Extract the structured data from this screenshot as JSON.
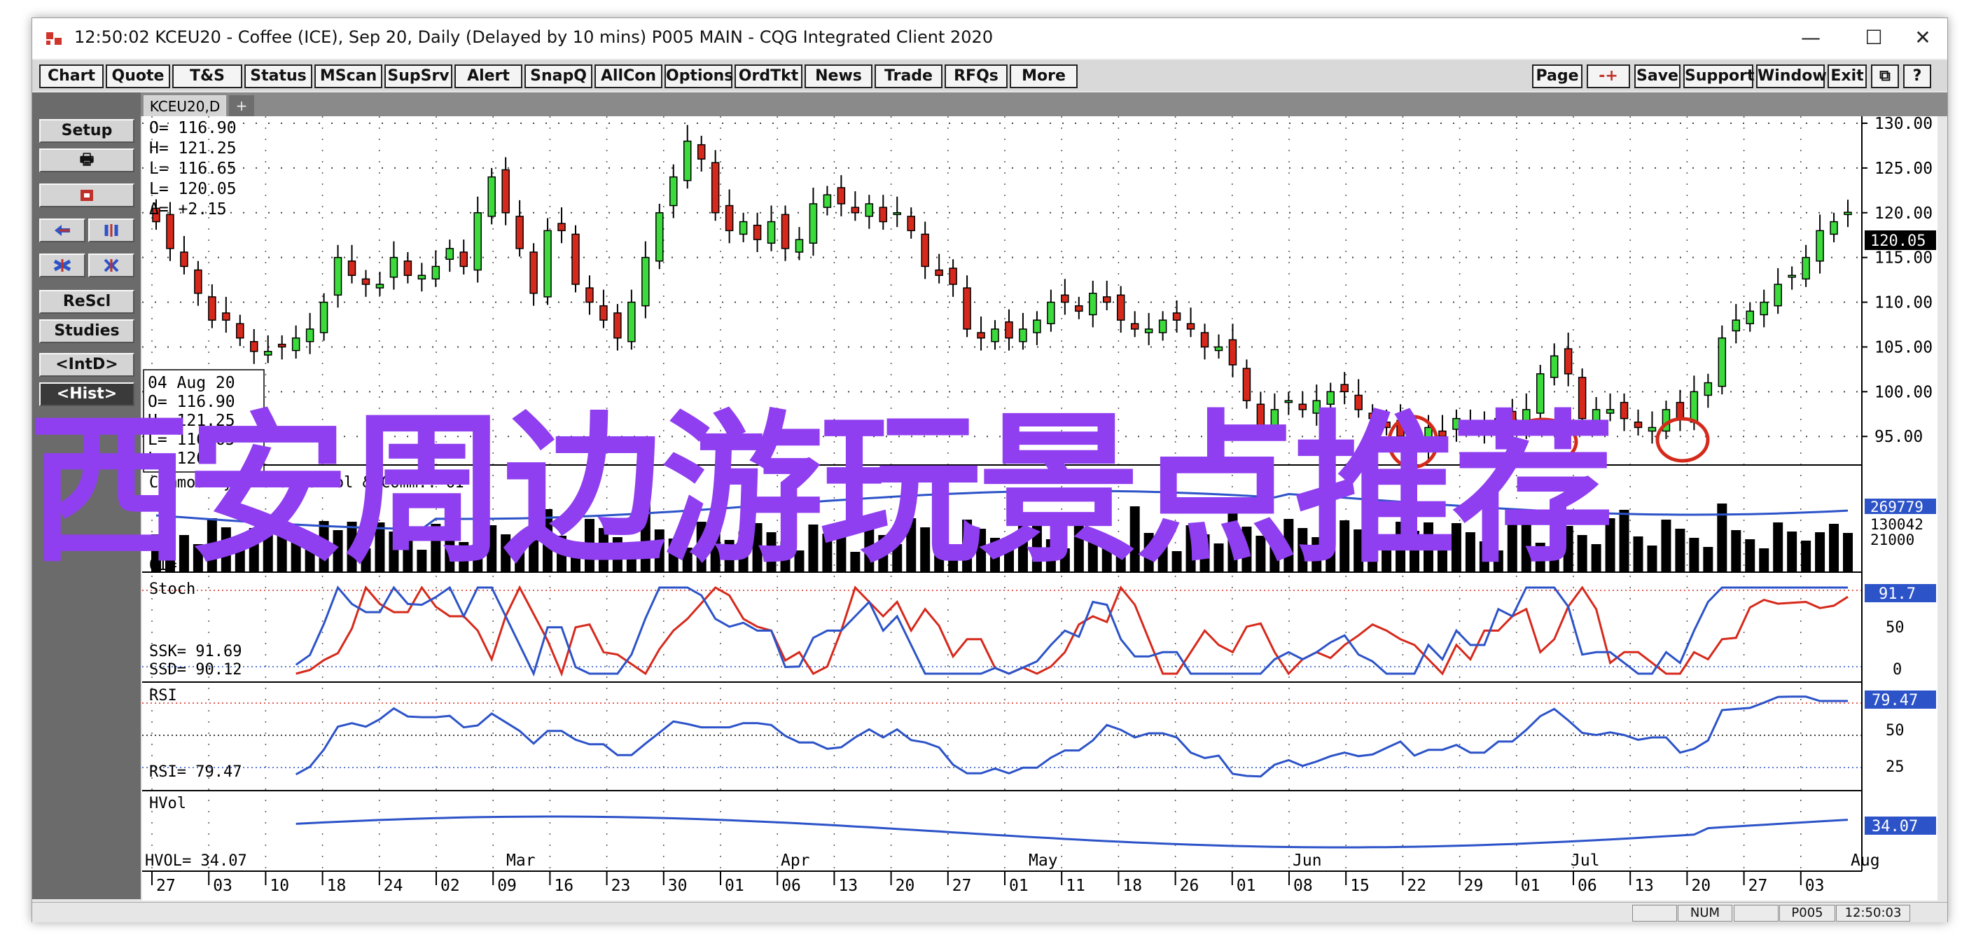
{
  "window": {
    "title": "12:50:02   KCEU20 - Coffee (ICE), Sep 20, Daily (Delayed by 10 mins)   P005 MAIN - CQG Integrated Client 2020",
    "minimize": "—",
    "maximize": "☐",
    "close": "✕"
  },
  "menu": {
    "left": [
      "Chart",
      "Quote",
      "T&S",
      "Status",
      "MScan",
      "SupSrv",
      "Alert",
      "SnapQ",
      "AllCon",
      "Options",
      "OrdTkt",
      "News",
      "Trade",
      "RFQs",
      "More"
    ],
    "right": [
      "Page",
      "-+",
      "Save",
      "Support",
      "Window",
      "Exit",
      "⧉",
      "?"
    ]
  },
  "sidebar": {
    "setup": "Setup",
    "print": "🖶",
    "rescl": "ReScl",
    "studies": "Studies",
    "intd": "<IntD>",
    "hist": "<Hist>"
  },
  "tabs": {
    "active": "KCEU20,D",
    "add": "+"
  },
  "status": {
    "num": "NUM",
    "profile": "P005",
    "time": "12:50:03"
  },
  "overlay_text": "西安周边游玩景点推荐",
  "chart_data": {
    "type": "candlestick",
    "symbol": "KCEU20,D",
    "ohlc_readout": {
      "O": "116.90",
      "H": "121.25",
      "L": "116.65",
      "Last": "120.05",
      "delta": "+2.15"
    },
    "cursor_box": {
      "date": "04 Aug 20",
      "O": "116.90",
      "H": "121.25",
      "L": "116.65",
      "Last": "120"
    },
    "price_ylim": [
      94,
      130
    ],
    "price_ticks": [
      "130.00",
      "125.00",
      "120.00",
      "115.00",
      "110.00",
      "105.00",
      "100.00",
      "95.00"
    ],
    "last_price_label": "120.05",
    "closes": [
      119,
      116,
      114,
      111,
      108,
      108,
      106,
      104.5,
      104.5,
      105,
      106,
      107,
      110,
      115,
      113,
      112,
      112,
      115,
      113,
      113,
      114,
      116,
      114,
      120,
      124,
      120,
      116,
      111,
      118,
      118,
      112,
      110,
      108,
      106,
      110,
      115,
      120,
      124,
      128,
      126,
      120,
      118,
      119,
      117,
      119,
      116,
      117,
      121,
      122,
      121,
      120,
      121,
      119,
      120,
      118,
      114,
      113,
      112,
      107,
      106,
      107,
      106,
      107,
      108,
      110,
      110,
      109,
      111,
      110,
      108,
      107,
      107,
      108,
      108,
      107,
      105,
      105,
      103,
      99,
      96,
      98,
      99,
      98,
      99,
      100,
      100,
      98,
      97,
      96,
      95,
      94,
      96,
      95,
      97,
      96,
      96,
      97,
      96,
      98,
      102,
      104,
      102,
      97,
      98,
      98,
      97,
      96,
      96,
      98,
      97,
      100,
      101,
      106,
      108,
      109,
      110,
      112,
      113,
      115,
      118,
      119,
      120.05
    ],
    "oi_panel": {
      "title": "Commodity Exchange Vol & Comm.. OI",
      "labels": [
        "269779",
        "130042",
        "21000"
      ],
      "readout": "OI="
    },
    "stoch_panel": {
      "title": "Stoch",
      "ssk": "91.69",
      "ssd": "90.12",
      "ticks": [
        "50",
        "0"
      ],
      "label": "91.7"
    },
    "rsi_panel": {
      "title": "RSI",
      "value": "79.47",
      "ticks": [
        "50",
        "25"
      ],
      "label": "79.47"
    },
    "hvol_panel": {
      "title": "HVol",
      "value": "34.07",
      "label": "34.07"
    },
    "months": [
      "Mar",
      "Apr",
      "May",
      "Jun",
      "Jul",
      "Aug"
    ],
    "days": [
      "27",
      "03",
      "10",
      "18",
      "24",
      "02",
      "09",
      "16",
      "23",
      "30",
      "01",
      "06",
      "13",
      "20",
      "27",
      "01",
      "11",
      "18",
      "26",
      "01",
      "08",
      "15",
      "22",
      "29",
      "01",
      "06",
      "13",
      "20",
      "27",
      "03"
    ]
  }
}
